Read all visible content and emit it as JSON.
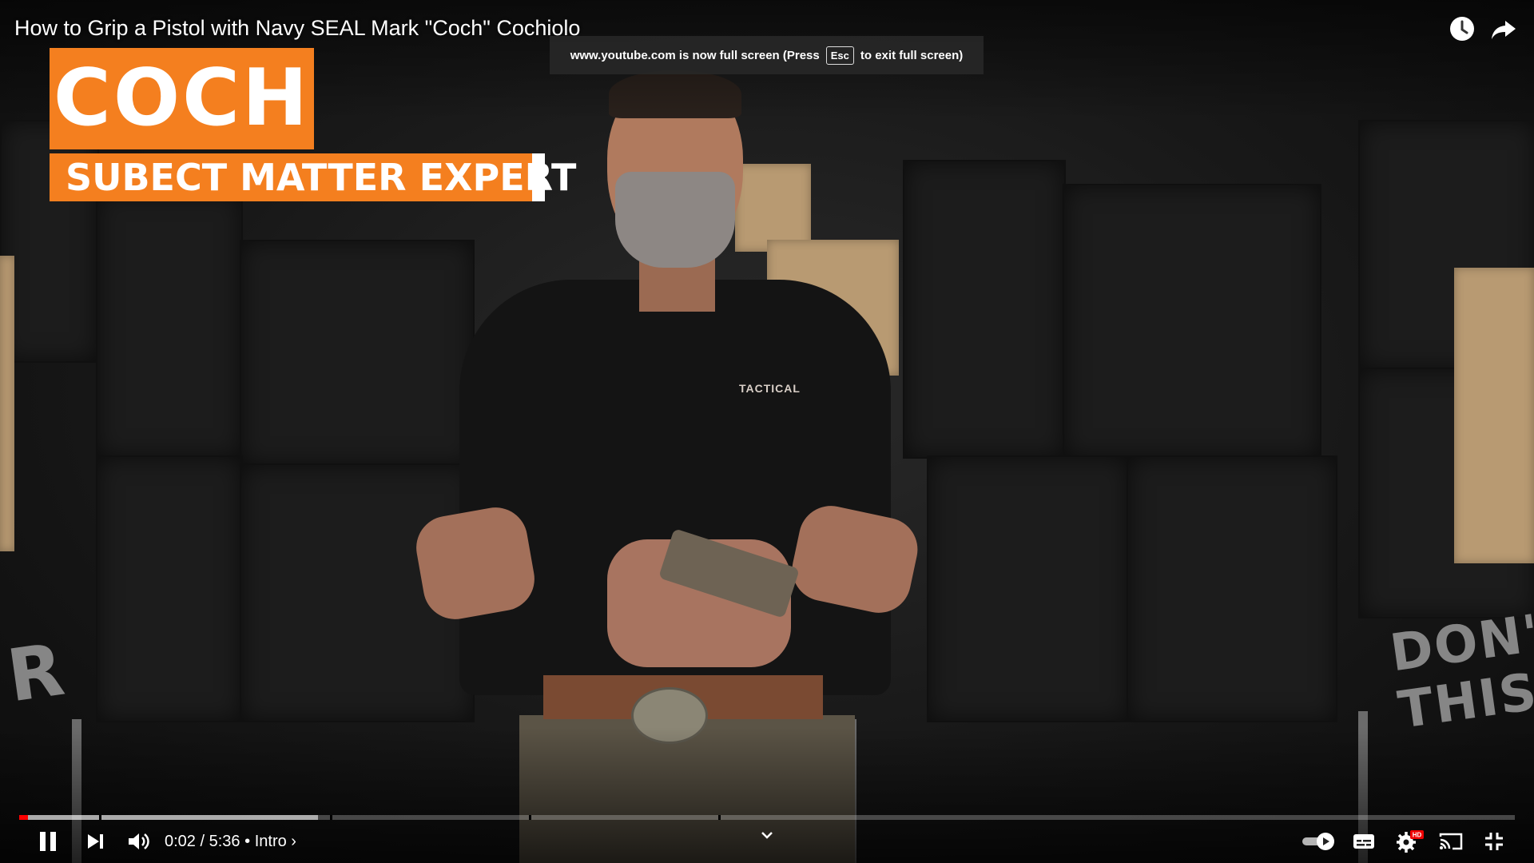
{
  "video": {
    "title": "How to Grip a Pistol with Navy SEAL Mark \"Coch\" Cochiolo",
    "shirt_logo": "TACTICAL",
    "chalk_left": "R",
    "chalk_right": "DON'T THIS"
  },
  "fullscreen_notice": {
    "before": "www.youtube.com is now full screen (Press",
    "key": "Esc",
    "after": "to exit full screen)"
  },
  "lower_third": {
    "name": "COCH",
    "role": "SUBECT MATTER EXPERT",
    "color": "#f47f1f"
  },
  "player": {
    "current_time": "0:02",
    "separator": "/",
    "duration": "5:36",
    "chapter_bullet": "•",
    "chapter": "Intro",
    "chapter_chevron": "›",
    "played_fraction": 0.006,
    "loaded_fraction": 0.2,
    "accent_color": "#ff0000",
    "hd_badge": "HD",
    "icons": {
      "pause": "pause-icon",
      "next": "next-icon",
      "volume": "volume-icon",
      "chapters": "chevron-down-icon",
      "autoplay": "autoplay-toggle",
      "subtitles": "subtitles-icon",
      "settings": "settings-gear-icon",
      "cast": "cast-icon",
      "exit_fullscreen": "exit-fullscreen-icon",
      "watch_later": "clock-icon",
      "share": "share-icon"
    }
  }
}
